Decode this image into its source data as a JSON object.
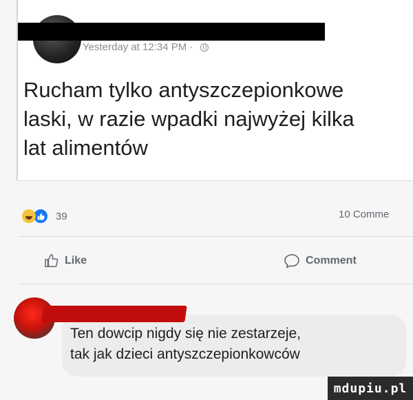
{
  "post": {
    "timestamp": "Yesterday at 12:34 PM",
    "separator": "·",
    "audience_icon": "globe-icon",
    "text": "Rucham tylko antyszczepionkowe\nlaski, w razie wpadki najwyżej kilka\nlat alimentów"
  },
  "stats": {
    "reaction_icons": [
      "haha-emoji-icon",
      "like-badge-icon"
    ],
    "reaction_count": "39",
    "comment_count": "10 Comme"
  },
  "actions": {
    "like_label": "Like",
    "comment_label": "Comment",
    "like_icon": "thumbs-up-icon",
    "comment_icon": "speech-bubble-icon"
  },
  "comment": {
    "text": "Ten dowcip nigdy się nie zestarzeje,\ntak jak dzieci antyszczepionkowców"
  },
  "watermark": {
    "text": "mdupiu.pl"
  },
  "colors": {
    "background": "#f6f6f6",
    "card": "#ffffff",
    "text": "#1c1e21",
    "muted": "#606770",
    "like_blue": "#1877f2",
    "bubble": "#ececec",
    "redaction_red": "#c10d0d"
  }
}
